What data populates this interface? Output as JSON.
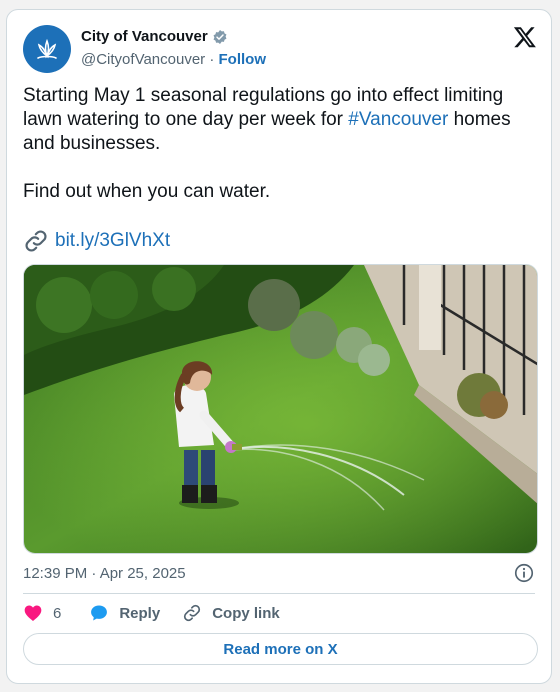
{
  "account": {
    "name": "City of Vancouver",
    "handle": "@CityofVancouver",
    "separator": "·",
    "follow_label": "Follow"
  },
  "tweet": {
    "text_before": "Starting May 1 seasonal regulations go into effect limiting lawn watering to one day per week for ",
    "hashtag": "#Vancouver",
    "text_after": " homes and businesses.",
    "text_line2": "Find out when you can water.",
    "link": "bit.ly/3GlVhXt"
  },
  "timestamp": "12:39 PM · Apr 25, 2025",
  "actions": {
    "like_count": "6",
    "reply_label": "Reply",
    "copy_label": "Copy link"
  },
  "read_more_label": "Read more on X",
  "colors": {
    "accent": "#1d70b8",
    "like": "#f91880",
    "text_secondary": "#536471"
  }
}
